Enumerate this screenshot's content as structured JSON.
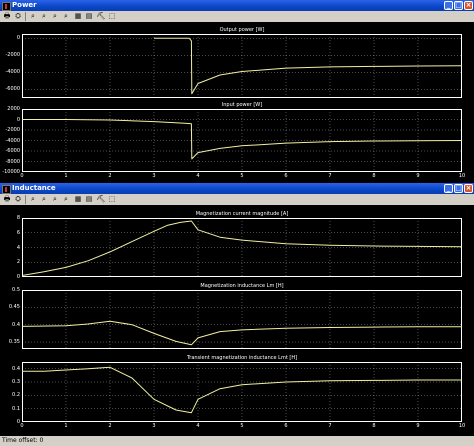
{
  "windows": {
    "power": {
      "title": "Power",
      "controls": [
        "_",
        "□",
        "×"
      ],
      "toolbar": [
        "🖶",
        "⛭",
        "⌕",
        "⌕",
        "⌕",
        "⌕",
        "▦",
        "▤",
        "⛏",
        "⬚"
      ],
      "plots": [
        {
          "title": "Output power [W]",
          "yticks": [
            "0",
            "-2000",
            "-4000",
            "-6000"
          ],
          "ylim": [
            -7000,
            500
          ]
        },
        {
          "title": "Input power [W]",
          "yticks": [
            "2000",
            "0",
            "-2000",
            "-4000",
            "-6000",
            "-8000",
            "-10000"
          ],
          "ylim": [
            -10000,
            2000
          ]
        }
      ],
      "xticks": [
        "0",
        "1",
        "2",
        "3",
        "4",
        "5",
        "6",
        "7",
        "8",
        "9",
        "10"
      ]
    },
    "inductance": {
      "title": "Inductance",
      "controls": [
        "_",
        "□",
        "×"
      ],
      "toolbar": [
        "🖶",
        "⛭",
        "⌕",
        "⌕",
        "⌕",
        "⌕",
        "▦",
        "▤",
        "⛏",
        "⬚"
      ],
      "plots": [
        {
          "title": "Magnetization  current magnitude  [A]",
          "yticks": [
            "8",
            "6",
            "4",
            "2",
            "0"
          ],
          "ylim": [
            0,
            8
          ]
        },
        {
          "title": "Magnetization inductance  Lm [H]",
          "yticks": [
            "0.5",
            "0.45",
            "0.4",
            "0.35"
          ],
          "ylim": [
            0.33,
            0.5
          ]
        },
        {
          "title": "Transient magnetization inductance Lmt [H]",
          "yticks": [
            "0.4",
            "0.3",
            "0.2",
            "0.1",
            "0"
          ],
          "ylim": [
            0,
            0.45
          ]
        }
      ],
      "xticks": [
        "0",
        "1",
        "2",
        "3",
        "4",
        "5",
        "6",
        "7",
        "8",
        "9",
        "10"
      ],
      "status": "Time offset:  0"
    }
  },
  "colors": {
    "title_bar": "#0a46c8",
    "trace": "#f0f0a0",
    "grid": "#ffffff",
    "plot_bg": "#000000"
  },
  "chart_data": [
    {
      "type": "line",
      "title": "Output power [W]",
      "xlim": [
        0,
        10
      ],
      "ylim": [
        -7000,
        500
      ],
      "series": [
        {
          "x": [
            3,
            3.8,
            3.85,
            3.86,
            4.0,
            4.5,
            5,
            6,
            7,
            8,
            9,
            10
          ],
          "y": [
            0,
            0,
            -300,
            -6500,
            -5300,
            -4300,
            -3900,
            -3500,
            -3350,
            -3300,
            -3250,
            -3230
          ]
        }
      ]
    },
    {
      "type": "line",
      "title": "Input power [W]",
      "xlim": [
        0,
        10
      ],
      "ylim": [
        -10000,
        2000
      ],
      "series": [
        {
          "x": [
            0,
            1,
            2,
            3,
            3.7,
            3.85,
            3.86,
            4.0,
            4.5,
            5,
            6,
            7,
            8,
            9,
            10
          ],
          "y": [
            0,
            0,
            -100,
            -400,
            -700,
            -800,
            -7500,
            -6300,
            -5500,
            -5000,
            -4500,
            -4200,
            -4100,
            -4050,
            -4000
          ]
        }
      ]
    },
    {
      "type": "line",
      "title": "Magnetization  current magnitude  [A]",
      "xlim": [
        0,
        10
      ],
      "ylim": [
        0,
        8
      ],
      "series": [
        {
          "x": [
            0,
            0.5,
            1,
            1.5,
            2,
            2.5,
            3,
            3.3,
            3.6,
            3.85,
            4.0,
            4.5,
            5,
            6,
            7,
            8,
            9,
            10
          ],
          "y": [
            0.2,
            0.7,
            1.3,
            2.2,
            3.4,
            4.8,
            6.2,
            7.0,
            7.4,
            7.6,
            6.4,
            5.4,
            5.0,
            4.5,
            4.3,
            4.2,
            4.15,
            4.1
          ]
        }
      ]
    },
    {
      "type": "line",
      "title": "Magnetization inductance  Lm [H]",
      "xlim": [
        0,
        10
      ],
      "ylim": [
        0.33,
        0.5
      ],
      "series": [
        {
          "x": [
            0,
            1,
            1.5,
            2,
            2.5,
            3,
            3.5,
            3.85,
            4.0,
            4.5,
            5,
            6,
            7,
            8,
            9,
            10
          ],
          "y": [
            0.395,
            0.397,
            0.402,
            0.41,
            0.4,
            0.375,
            0.352,
            0.342,
            0.362,
            0.38,
            0.385,
            0.39,
            0.392,
            0.393,
            0.394,
            0.394
          ]
        }
      ]
    },
    {
      "type": "line",
      "title": "Transient magnetization inductance Lmt [H]",
      "xlim": [
        0,
        10
      ],
      "ylim": [
        0,
        0.45
      ],
      "series": [
        {
          "x": [
            0,
            0.5,
            1,
            1.5,
            2,
            2.5,
            3,
            3.5,
            3.85,
            4.0,
            4.5,
            5,
            6,
            7,
            8,
            9,
            10
          ],
          "y": [
            0.38,
            0.38,
            0.39,
            0.4,
            0.41,
            0.33,
            0.17,
            0.09,
            0.07,
            0.17,
            0.25,
            0.28,
            0.3,
            0.31,
            0.312,
            0.315,
            0.315
          ]
        }
      ]
    }
  ]
}
